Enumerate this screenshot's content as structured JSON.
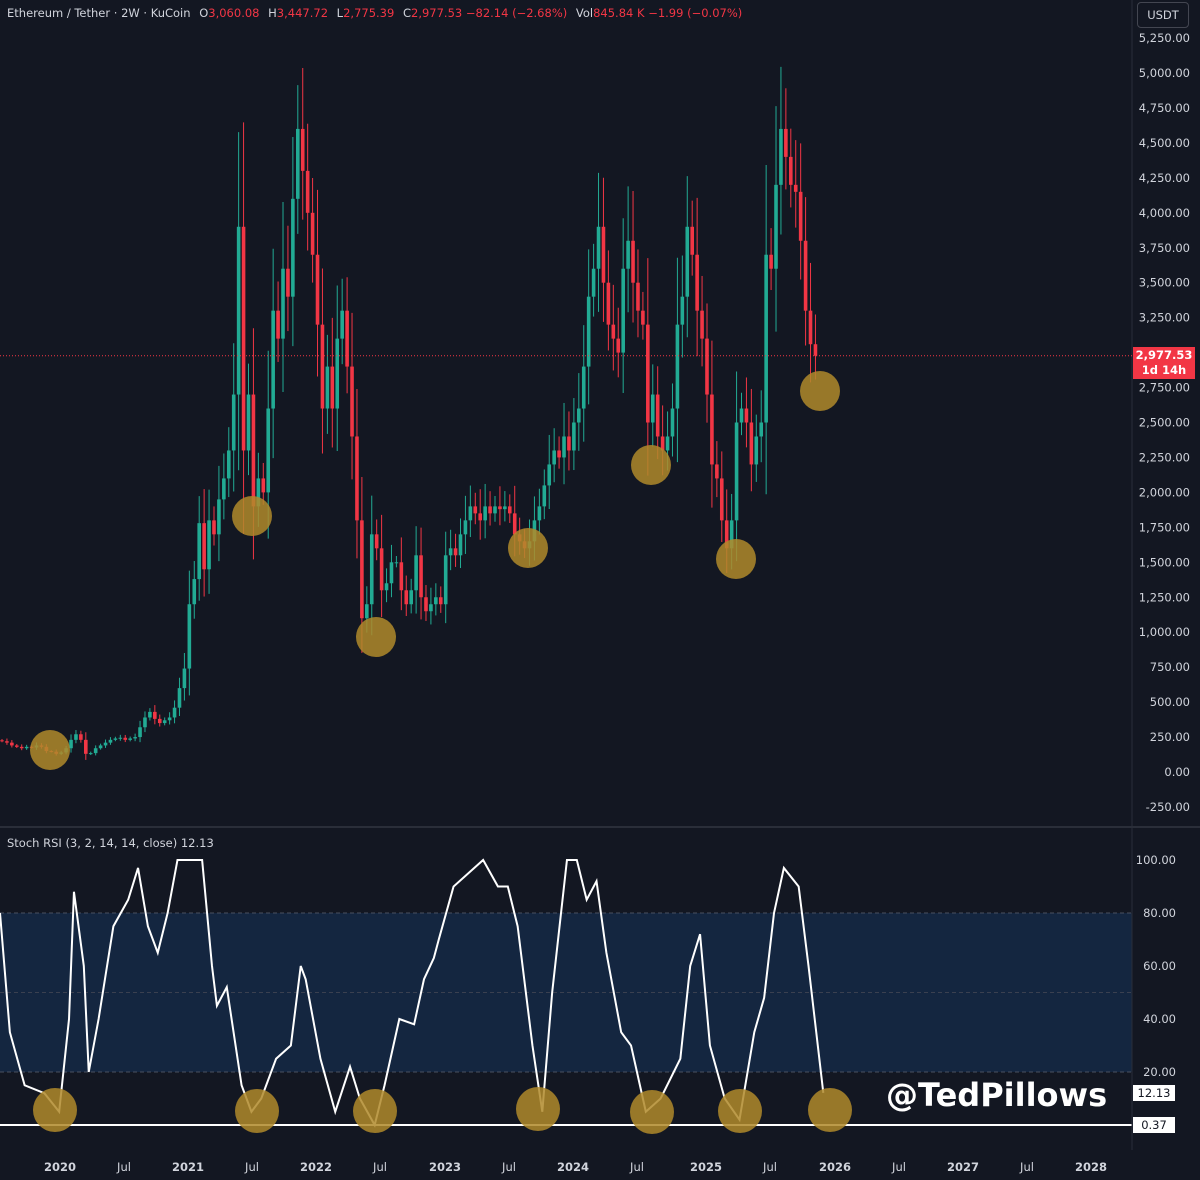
{
  "header": {
    "symbol": "Ethereum / Tether · 2W · KuCoin",
    "o_label": "O",
    "o": "3,060.08",
    "h_label": "H",
    "h": "3,447.72",
    "l_label": "L",
    "l": "2,775.39",
    "c_label": "C",
    "c": "2,977.53",
    "change": "−82.14 (−2.68%)",
    "vol_label": "Vol",
    "vol": "845.84 K",
    "vol_change": "−1.99 (−0.07%)"
  },
  "currency": "USDT",
  "price_tag": {
    "price": "2,977.53",
    "countdown": "1d 14h"
  },
  "rsi_legend": "Stoch RSI (3, 2, 14, 14, close)  12.13",
  "rsi_tags": {
    "k": "12.13",
    "d": "0.37"
  },
  "watermark": "@TedPillows",
  "colors": {
    "up": "#22ab94",
    "down": "#f23645",
    "bg": "#131722",
    "band": "#142640",
    "marker": "#b08a2a"
  },
  "chart_data": [
    {
      "type": "candlestick",
      "title": "Ethereum / Tether · 2W · KuCoin",
      "ylim": [
        -250,
        5250
      ],
      "y_ticks": [
        "-250.00",
        "0.00",
        "250.00",
        "500.00",
        "750.00",
        "1,000.00",
        "1,250.00",
        "1,500.00",
        "1,750.00",
        "2,000.00",
        "2,250.00",
        "2,500.00",
        "2,750.00",
        "3,000.00",
        "3,250.00",
        "3,500.00",
        "3,750.00",
        "4,000.00",
        "4,250.00",
        "4,500.00",
        "4,750.00",
        "5,000.00",
        "5,250.00"
      ],
      "x_ticks": [
        "2020",
        "Jul",
        "2021",
        "Jul",
        "2022",
        "Jul",
        "2023",
        "Jul",
        "2024",
        "Jul",
        "2025",
        "Jul",
        "2026",
        "Jul",
        "2027",
        "Jul",
        "2028"
      ],
      "start": "2019-07",
      "interval": "2W",
      "close": [
        220,
        210,
        190,
        180,
        170,
        180,
        175,
        190,
        180,
        150,
        145,
        130,
        140,
        170,
        230,
        270,
        230,
        130,
        135,
        170,
        190,
        210,
        230,
        240,
        245,
        230,
        240,
        250,
        320,
        390,
        430,
        380,
        350,
        370,
        390,
        460,
        600,
        740,
        1200,
        1380,
        1780,
        1450,
        1800,
        1700,
        1950,
        2100,
        2300,
        2700,
        3900,
        2300,
        2700,
        1900,
        2100,
        2000,
        2600,
        3300,
        3100,
        3600,
        3400,
        4100,
        4600,
        4300,
        4000,
        3700,
        3200,
        2600,
        2900,
        2600,
        3100,
        3300,
        2900,
        2400,
        1800,
        1100,
        1200,
        1700,
        1600,
        1300,
        1350,
        1500,
        1500,
        1300,
        1200,
        1300,
        1550,
        1250,
        1150,
        1200,
        1250,
        1200,
        1550,
        1600,
        1550,
        1700,
        1800,
        1900,
        1850,
        1800,
        1900,
        1850,
        1900,
        1880,
        1900,
        1850,
        1700,
        1650,
        1600,
        1650,
        1800,
        1900,
        2050,
        2200,
        2300,
        2250,
        2400,
        2300,
        2500,
        2600,
        2900,
        3400,
        3600,
        3900,
        3500,
        3200,
        3100,
        3000,
        3600,
        3800,
        3500,
        3300,
        3200,
        2500,
        2700,
        2400,
        2300,
        2400,
        2600,
        3200,
        3400,
        3900,
        3700,
        3300,
        3100,
        2700,
        2200,
        2100,
        1800,
        1600,
        1800,
        2500,
        2600,
        2500,
        2200,
        2400,
        2500,
        3700,
        3600,
        4200,
        4600,
        4400,
        4200,
        4150,
        3800,
        3300,
        3060,
        2977.53
      ],
      "current_price": 2977.53
    },
    {
      "type": "line",
      "title": "Stoch RSI (3, 2, 14, 14, close)",
      "ylim": [
        0,
        100
      ],
      "bands": [
        20,
        80
      ],
      "y_ticks": [
        "20.00",
        "40.00",
        "60.00",
        "80.00",
        "100.00"
      ],
      "index": [
        0,
        2,
        5,
        9,
        12,
        14,
        15,
        17,
        18,
        20,
        23,
        26,
        28,
        30,
        32,
        34,
        36,
        41,
        43,
        44,
        46,
        49,
        51,
        53,
        56,
        59,
        61,
        62,
        65,
        68,
        71,
        73,
        76,
        78,
        81,
        84,
        86,
        88,
        89,
        92,
        95,
        98,
        101,
        103,
        105,
        108,
        110,
        112,
        115,
        117,
        119,
        121,
        123,
        126,
        128,
        131,
        134,
        138,
        140,
        142,
        144,
        147,
        150,
        153,
        155,
        157,
        159,
        162,
        164,
        167
      ],
      "values": [
        80,
        35,
        15,
        12,
        5,
        40,
        88,
        60,
        20,
        40,
        75,
        85,
        97,
        75,
        65,
        80,
        100,
        100,
        60,
        45,
        52,
        15,
        5,
        10,
        25,
        30,
        60,
        55,
        25,
        5,
        22,
        10,
        0,
        15,
        40,
        38,
        55,
        63,
        70,
        90,
        95,
        100,
        90,
        90,
        75,
        30,
        5,
        50,
        100,
        100,
        85,
        92,
        65,
        35,
        30,
        5,
        10,
        25,
        60,
        72,
        30,
        10,
        2,
        35,
        48,
        80,
        97,
        90,
        60,
        12.13
      ]
    }
  ]
}
